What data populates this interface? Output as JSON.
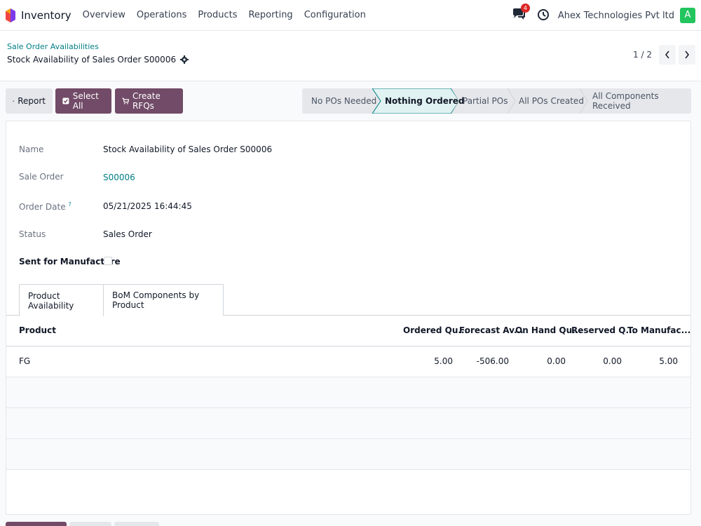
{
  "topbar": {
    "app_name": "Inventory",
    "menu": [
      "Overview",
      "Operations",
      "Products",
      "Reporting",
      "Configuration"
    ],
    "notification_count": "4",
    "company": "Ahex Technologies Pvt ltd",
    "avatar_letter": "A"
  },
  "control_panel": {
    "breadcrumb": "Sale Order Availabilities",
    "record_title": "Stock Availability of Sales Order S00006",
    "pager": "1 / 2"
  },
  "actions": {
    "report": "Report",
    "select_all": "Select All",
    "create_rfqs": "Create RFQs"
  },
  "statusbar": {
    "stages": [
      "No POs Needed",
      "Nothing Ordered",
      "Partial POs",
      "All POs Created",
      "All Components Received"
    ],
    "active_stage": "Nothing Ordered"
  },
  "form": {
    "name_label": "Name",
    "name_value": "Stock Availability of Sales Order S00006",
    "sale_order_label": "Sale Order",
    "sale_order_value": "S00006",
    "order_date_label": "Order Date",
    "order_date_help": "?",
    "order_date_value": "05/21/2025 16:44:45",
    "status_label": "Status",
    "status_value": "Sales Order",
    "sent_label": "Sent for Manufacture"
  },
  "tabs": [
    "Product Availability",
    "BoM Components by Product"
  ],
  "table": {
    "columns": [
      "Product",
      "Ordered Qu...",
      "Forecast Av...",
      "On Hand Qu...",
      "Reserved Q...",
      "To Manufac..."
    ],
    "rows": [
      [
        "FG",
        "5.00",
        "-506.00",
        "0.00",
        "0.00",
        "5.00"
      ]
    ]
  },
  "colors": {
    "brand": "#714b67",
    "link": "#017e84",
    "avatar": "#22c55e",
    "badge": "#dc2626"
  }
}
